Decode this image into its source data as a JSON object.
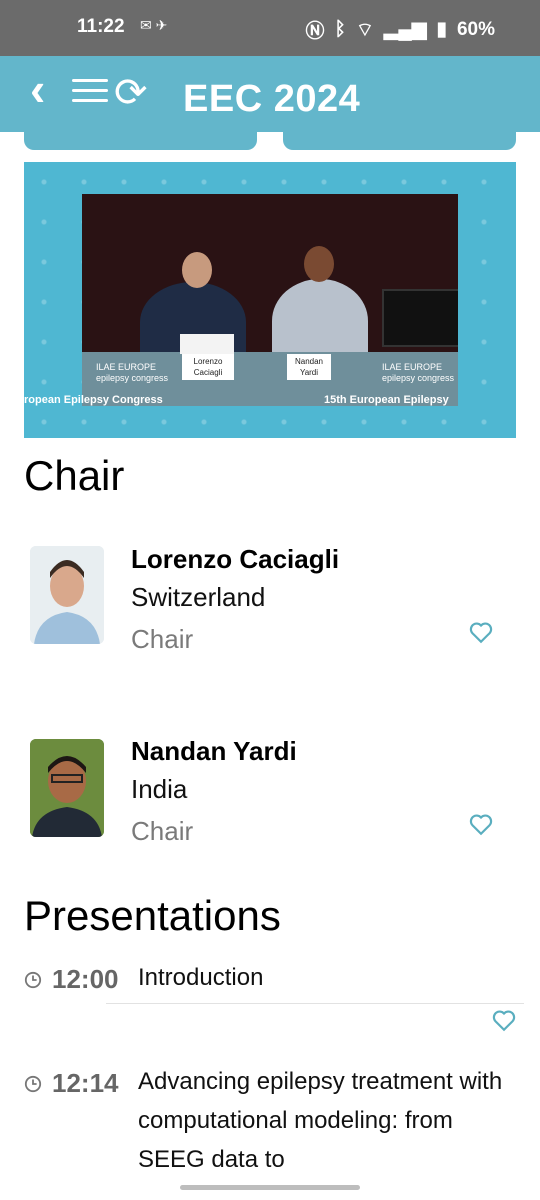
{
  "status_bar": {
    "time": "11:22",
    "battery": "60%"
  },
  "app_bar": {
    "title": "EEC 2024",
    "back_icon": "chevron-left-icon",
    "menu_icon": "hamburger-icon",
    "refresh_icon": "refresh-icon"
  },
  "video": {
    "caption_left": "ropean Epilepsy Congress",
    "caption_right": "15th European Epilepsy",
    "banner_left_logo": "ILAE EUROPE",
    "banner_left_text": "epilepsy congress",
    "banner_right_logo": "ILAE EUROPE",
    "banner_right_text": "epilepsy congress",
    "nameplate_left": "Lorenzo Caciagli",
    "nameplate_right": "Nandan Yardi"
  },
  "chairs_section": {
    "title": "Chair",
    "people": [
      {
        "name": "Lorenzo Caciagli",
        "country": "Switzerland",
        "role": "Chair"
      },
      {
        "name": "Nandan Yardi",
        "country": "India",
        "role": "Chair"
      }
    ]
  },
  "presentations_section": {
    "title": "Presentations",
    "items": [
      {
        "time": "12:00",
        "title": "Introduction"
      },
      {
        "time": "12:14",
        "title": "Advancing epilepsy treatment with computational modeling: from SEEG data to"
      }
    ]
  },
  "colors": {
    "accent": "#63b6cb",
    "status_bar": "#6b6b6b",
    "heart": "#5aaebf"
  }
}
